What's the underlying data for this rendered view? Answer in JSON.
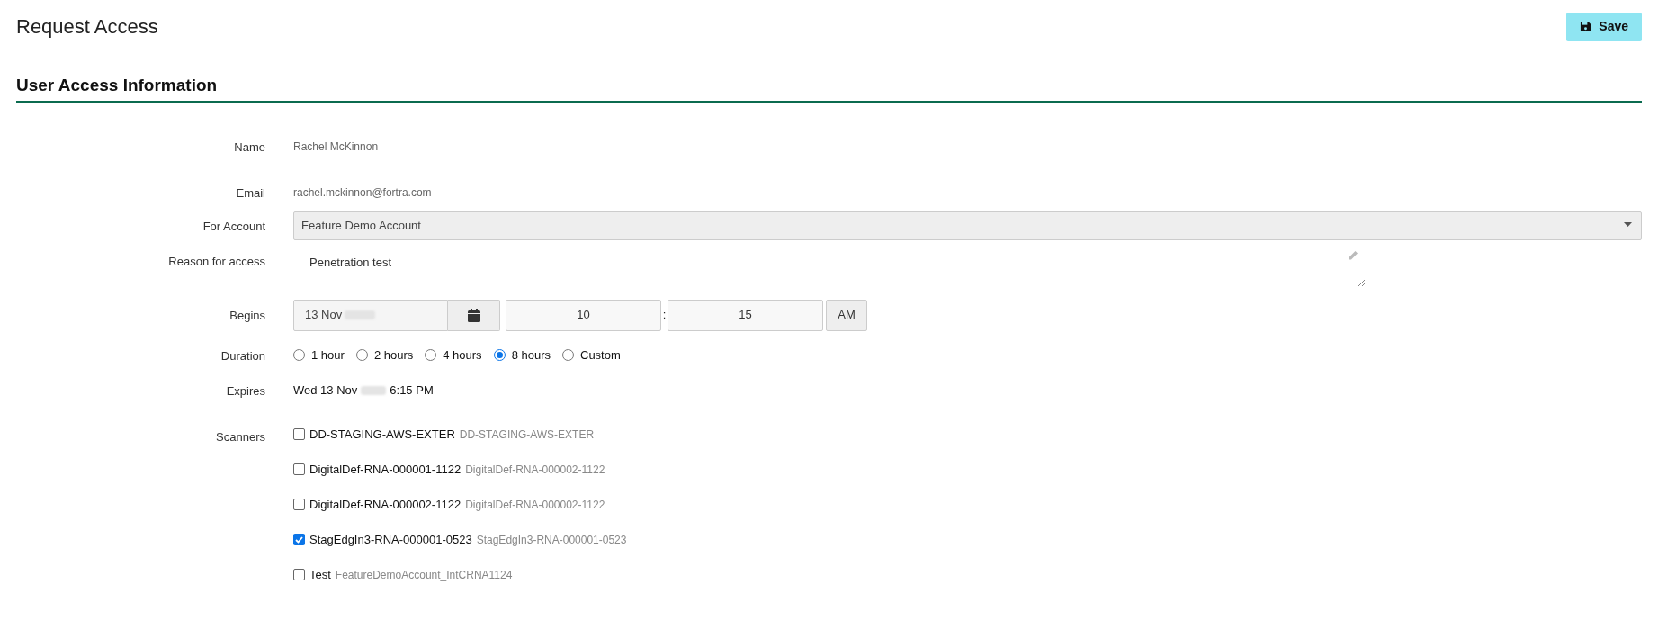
{
  "page": {
    "title": "Request Access",
    "save_button": "Save"
  },
  "section": {
    "title": "User Access Information"
  },
  "fields": {
    "name": {
      "label": "Name",
      "value": "Rachel McKinnon"
    },
    "email": {
      "label": "Email",
      "value": "rachel.mckinnon@fortra.com"
    },
    "account": {
      "label": "For Account",
      "value": "Feature Demo Account"
    },
    "reason": {
      "label": "Reason for access",
      "value": "Penetration test"
    },
    "begins": {
      "label": "Begins",
      "date": "13 Nov",
      "hour": "10",
      "separator": ":",
      "minute": "15",
      "meridiem": "AM"
    },
    "duration": {
      "label": "Duration",
      "options": [
        {
          "label": "1 hour",
          "selected": false
        },
        {
          "label": "2 hours",
          "selected": false
        },
        {
          "label": "4 hours",
          "selected": false
        },
        {
          "label": "8 hours",
          "selected": true
        },
        {
          "label": "Custom",
          "selected": false
        }
      ]
    },
    "expires": {
      "label": "Expires",
      "date": "Wed 13 Nov",
      "time": "6:15 PM"
    },
    "scanners": {
      "label": "Scanners",
      "items": [
        {
          "name": "DD-STAGING-AWS-EXTER",
          "detail": "DD-STAGING-AWS-EXTER",
          "checked": false
        },
        {
          "name": "DigitalDef-RNA-000001-1122",
          "detail": "DigitalDef-RNA-000002-1122",
          "checked": false
        },
        {
          "name": "DigitalDef-RNA-000002-1122",
          "detail": "DigitalDef-RNA-000002-1122",
          "checked": false
        },
        {
          "name": "StagEdgIn3-RNA-000001-0523",
          "detail": "StagEdgIn3-RNA-000001-0523",
          "checked": true
        },
        {
          "name": "Test",
          "detail": "FeatureDemoAccount_IntCRNA1124",
          "checked": false
        }
      ]
    }
  }
}
